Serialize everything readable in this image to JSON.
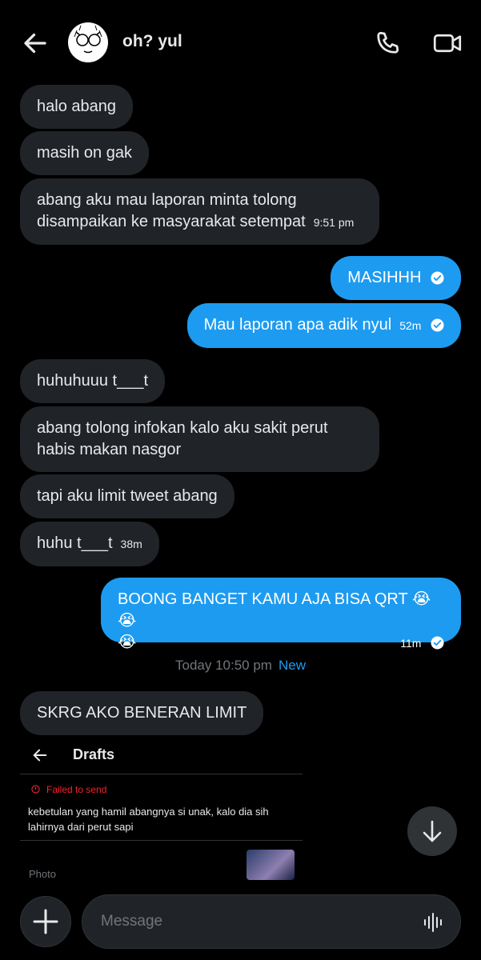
{
  "header": {
    "title": "oh? yul"
  },
  "messages": [
    {
      "dir": "in",
      "text": "halo abang"
    },
    {
      "dir": "in",
      "text": "masih on gak"
    },
    {
      "dir": "in",
      "line1": "abang aku mau laporan minta tolong",
      "line2": "disampaikan ke masyarakat setempat",
      "time": "9:51 pm"
    },
    {
      "dir": "out",
      "text": "MASIHHH"
    },
    {
      "dir": "out",
      "text": "Mau laporan apa adik nyul",
      "time": "52m"
    },
    {
      "dir": "in",
      "text": "huhuhuuu t___t"
    },
    {
      "dir": "in",
      "line1": "abang tolong infokan kalo aku sakit perut",
      "line2": "habis makan nasgor"
    },
    {
      "dir": "in",
      "text": "tapi aku limit tweet abang"
    },
    {
      "dir": "in",
      "text": "huhu t___t",
      "time": "38m"
    },
    {
      "dir": "out",
      "line1": "BOONG BANGET KAMU AJA BISA QRT 😭😭",
      "line2": "😭",
      "time": "11m"
    },
    {
      "dir": "in",
      "text": "SKRG AKO BENERAN LIMIT"
    }
  ],
  "divider": {
    "label": "Today 10:50 pm",
    "new_label": "New"
  },
  "drafts": {
    "title": "Drafts",
    "status": "Failed to send",
    "text": "kebetulan yang hamil abangnya si unak, kalo dia sih lahirnya dari perut sapi",
    "photo_label": "Photo"
  },
  "composer": {
    "placeholder": "Message"
  },
  "colors": {
    "accent": "#1d9bf0",
    "incoming_bubble": "#202327",
    "error": "#f4212e"
  },
  "icons": {
    "back": "back-arrow-icon",
    "call": "phone-icon",
    "video": "video-camera-icon",
    "check": "check-circle-icon",
    "scroll": "arrow-down-icon",
    "add": "plus-icon",
    "voice": "voice-wave-icon"
  }
}
